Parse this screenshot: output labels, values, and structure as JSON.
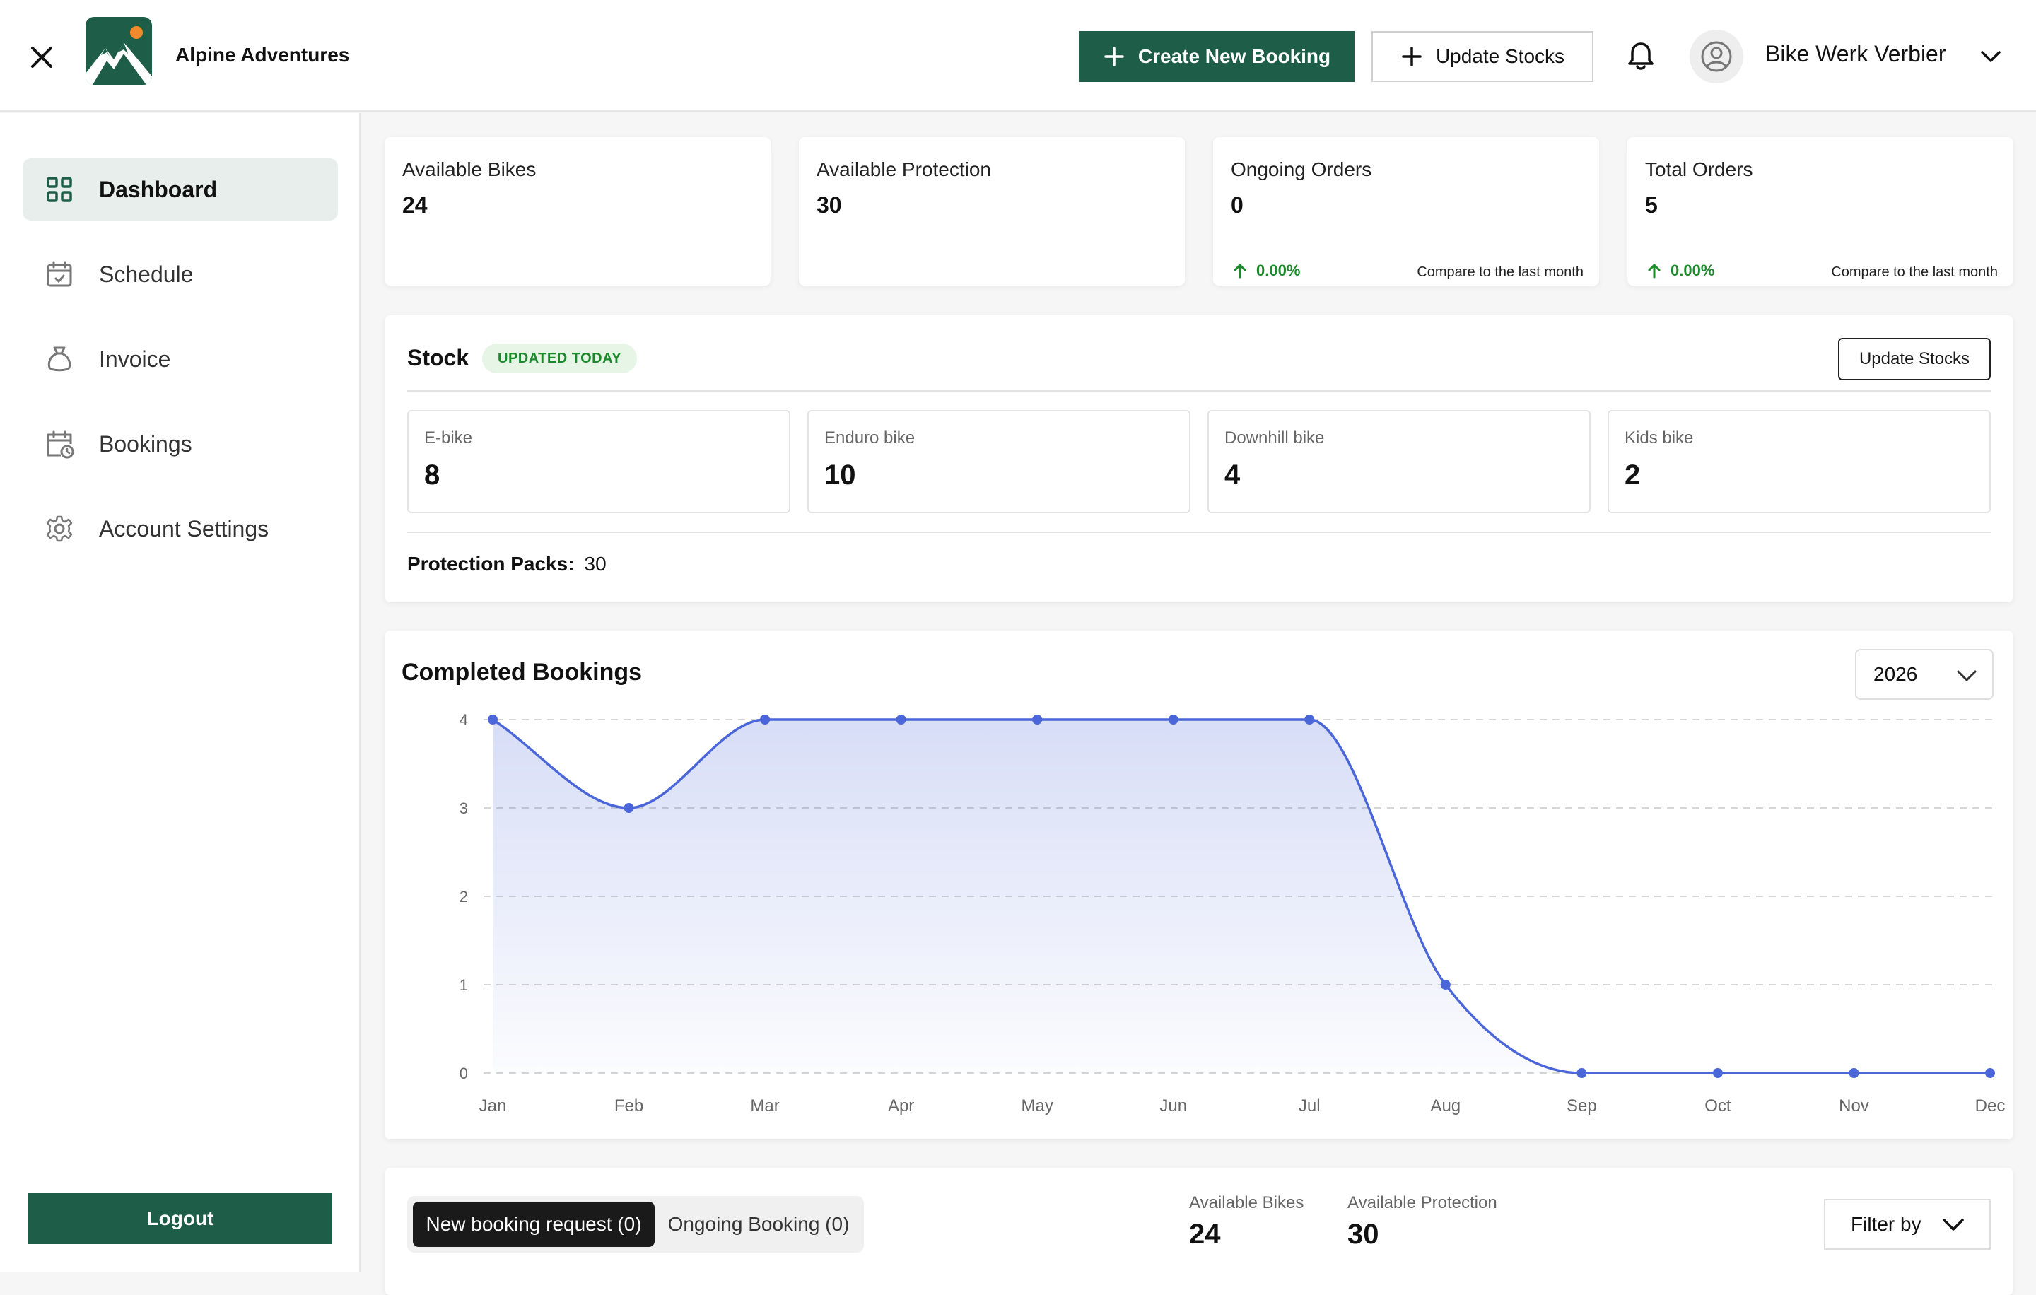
{
  "header": {
    "brand": "Alpine Adventures",
    "create_label": "Create New Booking",
    "update_label": "Update Stocks",
    "user_name": "Bike Werk Verbier"
  },
  "sidebar": {
    "items": [
      {
        "label": "Dashboard",
        "icon": "grid-icon",
        "active": true
      },
      {
        "label": "Schedule",
        "icon": "calendar-check-icon"
      },
      {
        "label": "Invoice",
        "icon": "money-bag-icon"
      },
      {
        "label": "Bookings",
        "icon": "calendar-clock-icon"
      },
      {
        "label": "Account Settings",
        "icon": "gear-icon"
      }
    ],
    "logout_label": "Logout"
  },
  "stats": [
    {
      "title": "Available Bikes",
      "value": "24"
    },
    {
      "title": "Available Protection",
      "value": "30"
    },
    {
      "title": "Ongoing Orders",
      "value": "0",
      "change": "0.00%",
      "compare": "Compare to the last month"
    },
    {
      "title": "Total Orders",
      "value": "5",
      "change": "0.00%",
      "compare": "Compare to the last month"
    }
  ],
  "stock": {
    "title": "Stock",
    "badge": "UPDATED TODAY",
    "button": "Update Stocks",
    "items": [
      {
        "label": "E-bike",
        "value": "8"
      },
      {
        "label": "Enduro bike",
        "value": "10"
      },
      {
        "label": "Downhill bike",
        "value": "4"
      },
      {
        "label": "Kids bike",
        "value": "2"
      }
    ],
    "packs_label": "Protection Packs:",
    "packs_value": "30"
  },
  "bookings_chart": {
    "title": "Completed Bookings",
    "year": "2026"
  },
  "chart_data": {
    "type": "area",
    "title": "Completed Bookings",
    "categories": [
      "Jan",
      "Feb",
      "Mar",
      "Apr",
      "May",
      "Jun",
      "Jul",
      "Aug",
      "Sep",
      "Oct",
      "Nov",
      "Dec"
    ],
    "values": [
      4,
      3,
      4,
      4,
      4,
      4,
      4,
      1,
      0,
      0,
      0,
      0
    ],
    "yticks": [
      0,
      1,
      2,
      3,
      4
    ],
    "ylim": [
      0,
      4
    ],
    "xlabel": "",
    "ylabel": "",
    "grid": true,
    "color": "#4a66d8"
  },
  "bottom": {
    "tab_new": "New booking request (0)",
    "tab_ongoing": "Ongoing Booking (0)",
    "bikes_label": "Available Bikes",
    "bikes_value": "24",
    "protection_label": "Available Protection",
    "protection_value": "30",
    "filter_label": "Filter by"
  },
  "colors": {
    "brand": "#1e5e48",
    "success": "#1a8a2a",
    "chart_line": "#4a66d8"
  }
}
